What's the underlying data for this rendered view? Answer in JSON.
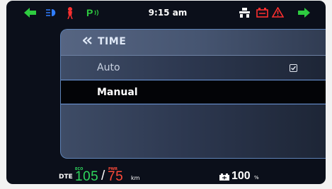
{
  "status_bar": {
    "time": "9:15 am",
    "icons": [
      "left-turn-indicator",
      "high-beam",
      "side-stand-warning",
      "parking-mode",
      "hazard-lights",
      "battery-warning",
      "general-warning",
      "right-turn-indicator"
    ],
    "colors": {
      "indicator_green": "#2ecc40",
      "warning_red": "#ff2f2f",
      "beam_blue": "#2f7dff",
      "parking_green": "#2ecc40"
    }
  },
  "menu": {
    "title": "TIME",
    "options": [
      {
        "label": "Auto",
        "selected": false,
        "checked": true
      },
      {
        "label": "Manual",
        "selected": true,
        "checked": false
      }
    ]
  },
  "bottom_bar": {
    "dte_label": "DTE",
    "eco_label": "ECO",
    "pwr_label": "PWR",
    "eco_range": "105",
    "separator": "/",
    "pwr_range": "75",
    "range_unit": "km",
    "battery_level": "100",
    "battery_unit": "%",
    "colors": {
      "eco": "#2fd65d",
      "pwr": "#ff4b3a"
    }
  }
}
